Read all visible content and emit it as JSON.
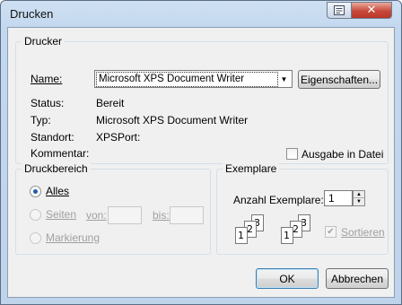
{
  "window": {
    "title": "Drucken"
  },
  "printer": {
    "legend": "Drucker",
    "name_label": "Name:",
    "selected": "Microsoft XPS Document Writer",
    "properties_button": "Eigenschaften...",
    "status_label": "Status:",
    "status_value": "Bereit",
    "type_label": "Typ:",
    "type_value": "Microsoft XPS Document Writer",
    "location_label": "Standort:",
    "location_value": "XPSPort:",
    "comment_label": "Kommentar:",
    "print_to_file_label": "Ausgabe in Datei",
    "print_to_file_checked": false
  },
  "range": {
    "legend": "Druckbereich",
    "all_label": "Alles",
    "pages_label": "Seiten",
    "from_label": "von:",
    "to_label": "bis:",
    "selection_label": "Markierung",
    "selected_option": "Alles"
  },
  "copies": {
    "legend": "Exemplare",
    "count_label": "Anzahl Exemplare:",
    "count_value": "1",
    "collate_label": "Sortieren",
    "collate_checked": true,
    "page_glyphs": [
      "1",
      "2",
      "3"
    ]
  },
  "buttons": {
    "ok": "OK",
    "cancel": "Abbrechen"
  },
  "icons": {
    "help": "help-icon",
    "close": "close-icon"
  }
}
